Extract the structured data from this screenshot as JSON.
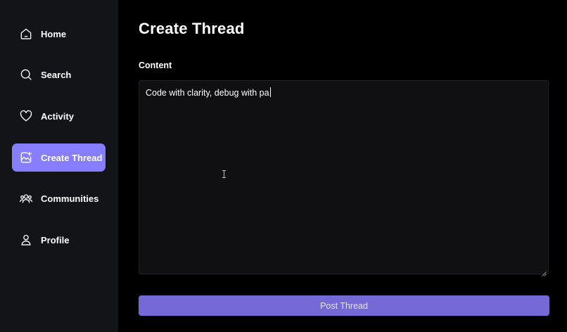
{
  "sidebar": {
    "items": [
      {
        "label": "Home",
        "icon": "home-icon",
        "active": false
      },
      {
        "label": "Search",
        "icon": "search-icon",
        "active": false
      },
      {
        "label": "Activity",
        "icon": "heart-icon",
        "active": false
      },
      {
        "label": "Create Thread",
        "icon": "image-plus-icon",
        "active": true
      },
      {
        "label": "Communities",
        "icon": "users-icon",
        "active": false
      },
      {
        "label": "Profile",
        "icon": "user-icon",
        "active": false
      }
    ]
  },
  "main": {
    "title": "Create Thread",
    "content_label": "Content",
    "content_value": "Code with clarity, debug with pa",
    "submit_label": "Post Thread"
  },
  "colors": {
    "accent": "#877eff",
    "button": "#7469d6",
    "sidebar_bg": "#121417",
    "page_bg": "#000000",
    "input_bg": "#101012"
  }
}
